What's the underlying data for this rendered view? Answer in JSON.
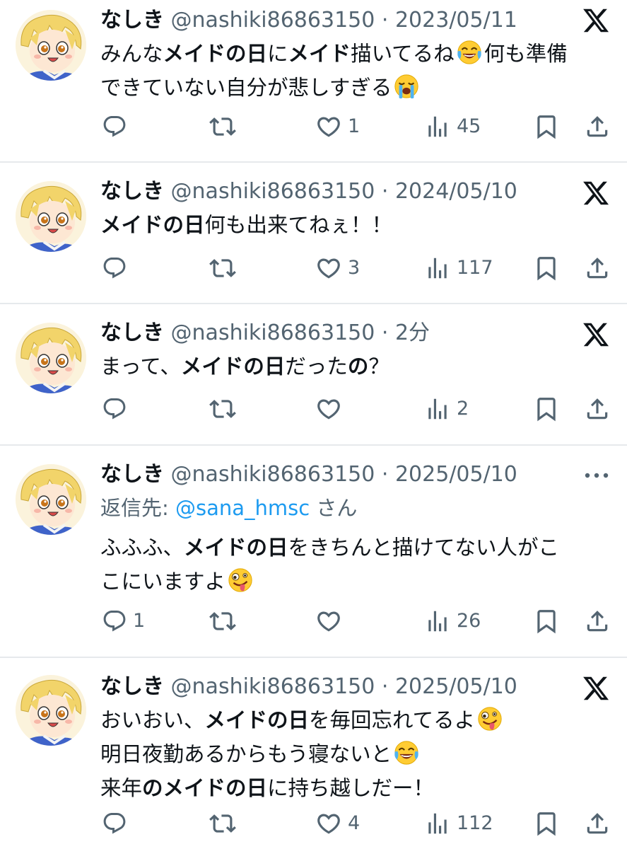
{
  "author": {
    "name": "なしき",
    "handle": "@nashiki86863150"
  },
  "separator": "·",
  "tweets": [
    {
      "date": "2023/05/11",
      "text": [
        "みんな",
        "メイドの日",
        "に",
        "メイド",
        "描いてるね",
        "何も準備",
        "できていない自分が悲しすぎる"
      ],
      "emoji": [
        "tears-of-joy",
        "loudly-crying"
      ],
      "corner": "x-logo",
      "counts": {
        "replies": "",
        "retweets": "",
        "likes": "1",
        "views": "45"
      }
    },
    {
      "date": "2024/05/10",
      "text": [
        "メイドの日",
        "何も出来てねぇ！！"
      ],
      "corner": "x-logo",
      "counts": {
        "replies": "",
        "retweets": "",
        "likes": "3",
        "views": "117"
      }
    },
    {
      "date": "2分",
      "text": [
        "まって、",
        "メイドの日",
        "だった",
        "の",
        "？"
      ],
      "corner": "x-logo",
      "counts": {
        "replies": "",
        "retweets": "",
        "likes": "",
        "views": "2"
      }
    },
    {
      "date": "2025/05/10",
      "reply_prefix": "返信先: ",
      "reply_mention": "@sana_hmsc",
      "reply_suffix": " さん",
      "text": [
        "ふふふ、",
        "メイドの日",
        "をきちんと描けてない人がこ",
        "こにいますよ"
      ],
      "emoji": [
        "zany-face"
      ],
      "corner": "more-icon",
      "counts": {
        "replies": "1",
        "retweets": "",
        "likes": "",
        "views": "26"
      }
    },
    {
      "date": "2025/05/10",
      "text": [
        "おいおい、",
        "メイドの日",
        "を毎回忘れてるよ",
        "明日夜勤あるからもう寝ないと",
        "来年",
        "のメイドの日",
        "に持ち越しだー！"
      ],
      "emoji": [
        "zany-face",
        "tears-of-joy"
      ],
      "corner": "x-logo",
      "counts": {
        "replies": "",
        "retweets": "",
        "likes": "4",
        "views": "112"
      }
    }
  ],
  "colors": {
    "text": "#0f1419",
    "muted": "#536471",
    "link": "#1d9bf0",
    "divider": "#e6e9ec"
  }
}
